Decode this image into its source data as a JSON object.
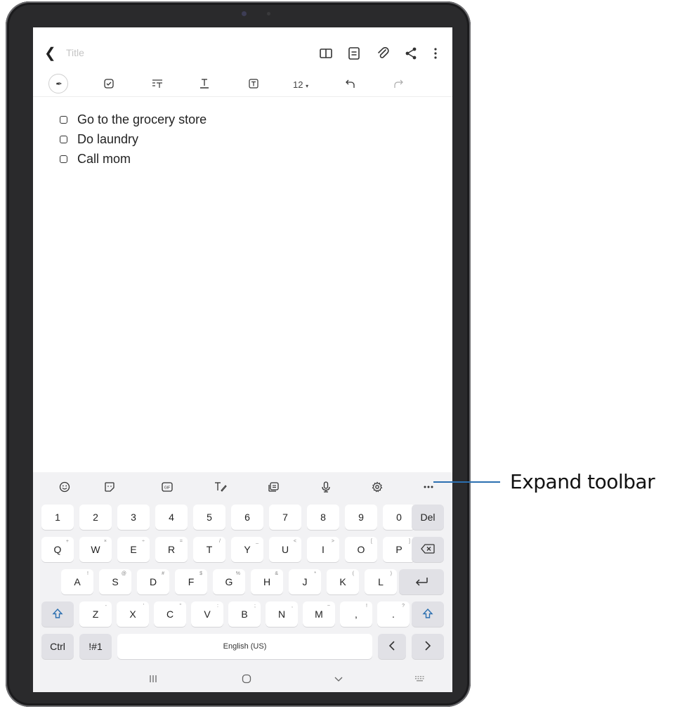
{
  "note": {
    "title_placeholder": "Title",
    "font_size": "12",
    "items": [
      "Go to the grocery store",
      "Do laundry",
      "Call mom"
    ]
  },
  "keyboard": {
    "number_row": [
      "1",
      "2",
      "3",
      "4",
      "5",
      "6",
      "7",
      "8",
      "9",
      "0"
    ],
    "del_label": "Del",
    "row_q": [
      {
        "k": "Q",
        "h": "+"
      },
      {
        "k": "W",
        "h": "×"
      },
      {
        "k": "E",
        "h": "÷"
      },
      {
        "k": "R",
        "h": "="
      },
      {
        "k": "T",
        "h": "/"
      },
      {
        "k": "Y",
        "h": "_"
      },
      {
        "k": "U",
        "h": "<"
      },
      {
        "k": "I",
        "h": ">"
      },
      {
        "k": "O",
        "h": "["
      },
      {
        "k": "P",
        "h": "]"
      }
    ],
    "row_a": [
      {
        "k": "A",
        "h": "!"
      },
      {
        "k": "S",
        "h": "@"
      },
      {
        "k": "D",
        "h": "#"
      },
      {
        "k": "F",
        "h": "$"
      },
      {
        "k": "G",
        "h": "%"
      },
      {
        "k": "H",
        "h": "&"
      },
      {
        "k": "J",
        "h": "*"
      },
      {
        "k": "K",
        "h": "("
      },
      {
        "k": "L",
        "h": ")"
      }
    ],
    "row_z": [
      {
        "k": "Z",
        "h": "-"
      },
      {
        "k": "X",
        "h": "'"
      },
      {
        "k": "C",
        "h": "\""
      },
      {
        "k": "V",
        "h": ":"
      },
      {
        "k": "B",
        "h": ";"
      },
      {
        "k": "N",
        "h": ","
      },
      {
        "k": "M",
        "h": "~"
      },
      {
        "k": ",",
        "h": "!"
      },
      {
        "k": ".",
        "h": "?"
      }
    ],
    "ctrl_label": "Ctrl",
    "symbols_label": "!#1",
    "space_label": "English (US)"
  },
  "callout": {
    "label": "Expand toolbar"
  },
  "icons": {
    "accent": "#2b6fb0",
    "names": [
      "back-icon",
      "reading-mode-icon",
      "page-icon",
      "attach-icon",
      "share-icon",
      "more-vert-icon",
      "pen-mode-icon",
      "checkbox-icon",
      "text-style-icon",
      "text-color-icon",
      "text-box-icon",
      "undo-icon",
      "redo-icon",
      "emoji-icon",
      "sticker-icon",
      "gif-icon",
      "handwriting-icon",
      "clipboard-icon",
      "mic-icon",
      "settings-icon",
      "more-horiz-icon",
      "backspace-icon",
      "enter-icon",
      "shift-icon",
      "left-arrow-icon",
      "right-arrow-icon",
      "recents-icon",
      "home-icon",
      "nav-back-icon",
      "keyboard-icon"
    ]
  }
}
